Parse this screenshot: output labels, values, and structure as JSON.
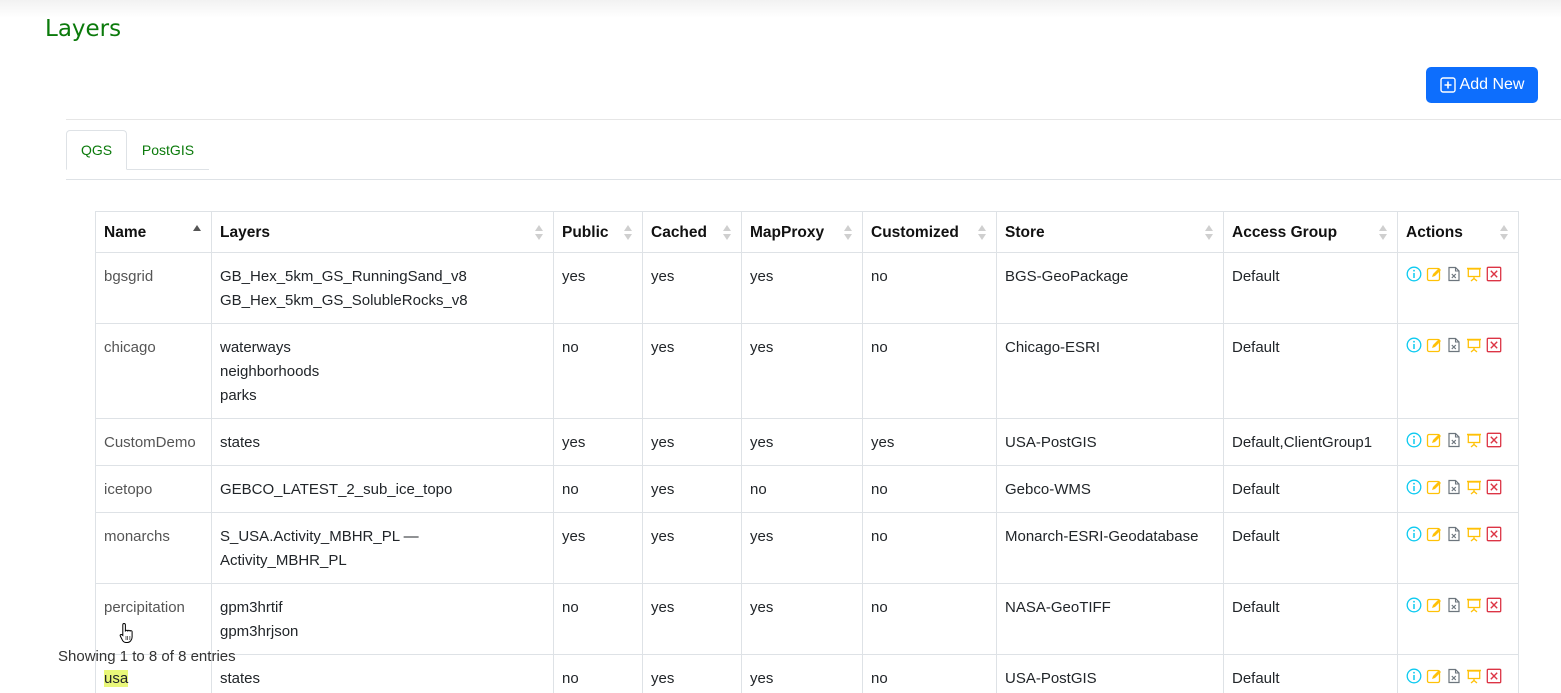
{
  "page": {
    "title": "Layers"
  },
  "toolbar": {
    "add_label": "Add New"
  },
  "tabs": [
    {
      "label": "QGS",
      "active": true
    },
    {
      "label": "PostGIS",
      "active": false
    }
  ],
  "table": {
    "columns": [
      "Name",
      "Layers",
      "Public",
      "Cached",
      "MapProxy",
      "Customized",
      "Store",
      "Access Group",
      "Actions"
    ],
    "sorted_column": "Name",
    "rows": [
      {
        "name": "bgsgrid",
        "layers": [
          "GB_Hex_5km_GS_RunningSand_v8",
          "GB_Hex_5km_GS_SolubleRocks_v8"
        ],
        "public": "yes",
        "cached": "yes",
        "mapproxy": "yes",
        "customized": "no",
        "store": "BGS-GeoPackage",
        "access_group": "Default"
      },
      {
        "name": "chicago",
        "layers": [
          "waterways",
          "neighborhoods",
          "parks"
        ],
        "public": "no",
        "cached": "yes",
        "mapproxy": "yes",
        "customized": "no",
        "store": "Chicago-ESRI",
        "access_group": "Default"
      },
      {
        "name": "CustomDemo",
        "layers": [
          "states"
        ],
        "public": "yes",
        "cached": "yes",
        "mapproxy": "yes",
        "customized": "yes",
        "store": "USA-PostGIS",
        "access_group": "Default,ClientGroup1"
      },
      {
        "name": "icetopo",
        "layers": [
          "GEBCO_LATEST_2_sub_ice_topo"
        ],
        "public": "no",
        "cached": "yes",
        "mapproxy": "no",
        "customized": "no",
        "store": "Gebco-WMS",
        "access_group": "Default"
      },
      {
        "name": "monarchs",
        "layers": [
          "S_USA.Activity_MBHR_PL — Activity_MBHR_PL"
        ],
        "public": "yes",
        "cached": "yes",
        "mapproxy": "yes",
        "customized": "no",
        "store": "Monarch-ESRI-Geodatabase",
        "access_group": "Default"
      },
      {
        "name": "percipitation",
        "layers": [
          "gpm3hrtif",
          "gpm3hrjson"
        ],
        "public": "no",
        "cached": "yes",
        "mapproxy": "yes",
        "customized": "no",
        "store": "NASA-GeoTIFF",
        "access_group": "Default"
      },
      {
        "name": "usa",
        "layers": [
          "states"
        ],
        "public": "no",
        "cached": "yes",
        "mapproxy": "yes",
        "customized": "no",
        "store": "USA-PostGIS",
        "access_group": "Default"
      }
    ],
    "actions": [
      {
        "icon": "info-icon",
        "color": "#0dcaf0"
      },
      {
        "icon": "edit-icon",
        "color": "#ffc107"
      },
      {
        "icon": "file-delete-icon",
        "color": "#6c757d"
      },
      {
        "icon": "presentation-icon",
        "color": "#ffc107"
      },
      {
        "icon": "close-box-icon",
        "color": "#dc3545"
      }
    ]
  },
  "footer": {
    "info": "Showing 1 to 8 of 8 entries"
  },
  "colors": {
    "accent": "#0d6efd",
    "title_green": "#0b7a0b"
  }
}
